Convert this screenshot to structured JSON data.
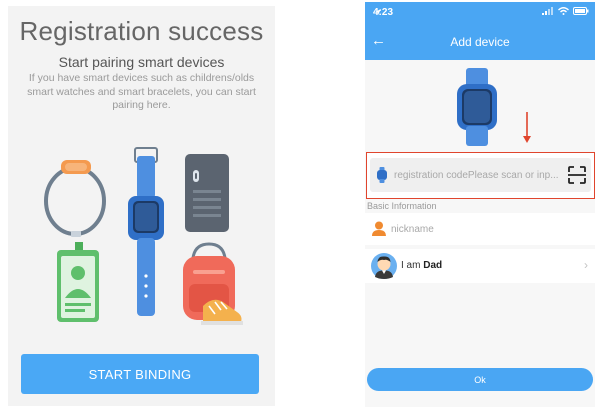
{
  "left": {
    "title": "Registration success",
    "subtitle": "Start pairing smart devices",
    "description": "If you have smart devices such as childrens/olds smart watches and smart bracelets, you can start pairing here.",
    "start_button": "START BINDING"
  },
  "right": {
    "status": {
      "time": "4:23"
    },
    "nav": {
      "back_icon": "back-arrow-icon",
      "title": "Add device"
    },
    "registration_field": {
      "placeholder": "registration codePlease scan or inp..."
    },
    "section_label": "Basic Information",
    "nickname_field": {
      "placeholder": "nickname"
    },
    "role_row": {
      "prefix": "I am",
      "value": "Dad"
    },
    "ok_button": "Ok"
  },
  "colors": {
    "accent": "#4aa6f3",
    "highlight_border": "#e0452d",
    "watch_blue": "#4e8fe0",
    "person_orange": "#f08a30"
  }
}
